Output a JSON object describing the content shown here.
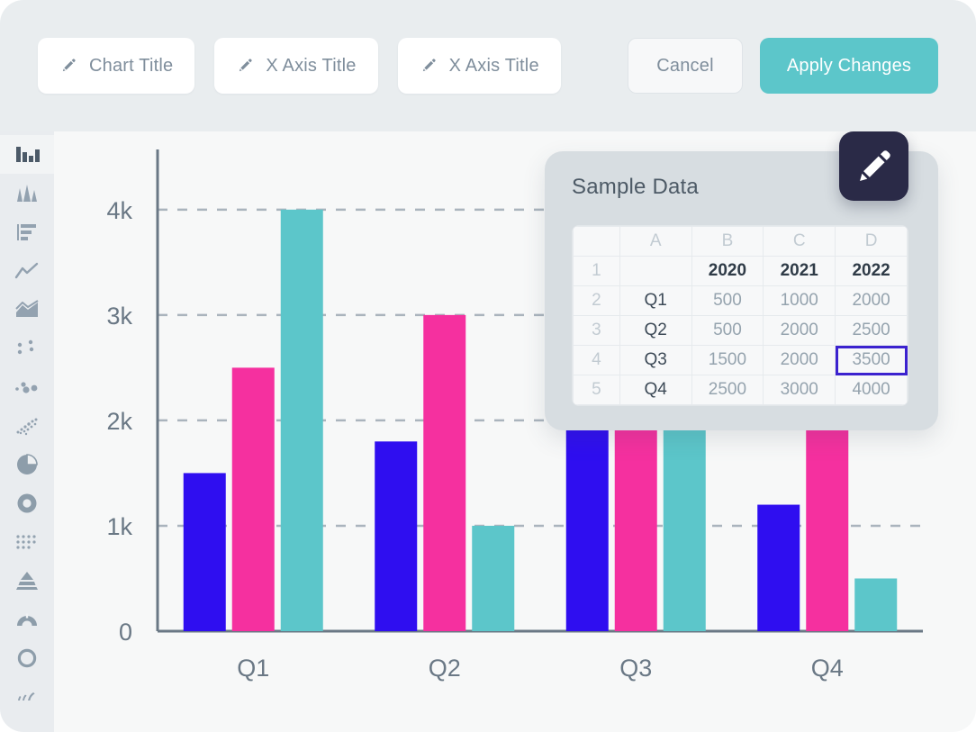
{
  "toolbar": {
    "chips": [
      {
        "icon": "pencil-icon",
        "label": "Chart Title"
      },
      {
        "icon": "pencil-icon",
        "label": "X Axis Title"
      },
      {
        "icon": "pencil-icon",
        "label": "X Axis Title"
      }
    ],
    "cancel_label": "Cancel",
    "apply_label": "Apply Changes",
    "accent_color": "#5cc6ca",
    "background": "#e9edef"
  },
  "sidebar": {
    "items": [
      {
        "name": "bar-chart-icon",
        "active": true
      },
      {
        "name": "column-spike-chart-icon",
        "active": false
      },
      {
        "name": "horizontal-bar-chart-icon",
        "active": false
      },
      {
        "name": "line-chart-icon",
        "active": false
      },
      {
        "name": "area-chart-icon",
        "active": false
      },
      {
        "name": "scatter-plot-icon",
        "active": false
      },
      {
        "name": "bubble-chart-icon",
        "active": false
      },
      {
        "name": "dot-density-chart-icon",
        "active": false
      },
      {
        "name": "pie-chart-icon",
        "active": false
      },
      {
        "name": "donut-chart-icon",
        "active": false
      },
      {
        "name": "dot-matrix-chart-icon",
        "active": false
      },
      {
        "name": "pyramid-chart-icon",
        "active": false
      },
      {
        "name": "gauge-chart-icon",
        "active": false
      },
      {
        "name": "ring-chart-icon",
        "active": false
      },
      {
        "name": "sparkline-chart-icon",
        "active": false
      }
    ]
  },
  "data_panel": {
    "title": "Sample Data",
    "edit_icon": "pencil-icon",
    "accent_selected_border": "#3b22cf",
    "columns": [
      "",
      "A",
      "B",
      "C",
      "D"
    ],
    "rows": [
      {
        "index": "1",
        "cells": [
          "",
          "2020",
          "2021",
          "2022"
        ],
        "style": "header"
      },
      {
        "index": "2",
        "cells": [
          "Q1",
          "500",
          "1000",
          "2000"
        ],
        "style": "data"
      },
      {
        "index": "3",
        "cells": [
          "Q2",
          "500",
          "2000",
          "2500"
        ],
        "style": "data"
      },
      {
        "index": "4",
        "cells": [
          "Q3",
          "1500",
          "2000",
          "3500"
        ],
        "style": "data",
        "selected_col": 3
      },
      {
        "index": "5",
        "cells": [
          "Q4",
          "2500",
          "3000",
          "4000"
        ],
        "style": "data"
      }
    ]
  },
  "chart_data": {
    "type": "bar",
    "title": "",
    "xlabel": "",
    "ylabel": "",
    "categories": [
      "Q1",
      "Q2",
      "Q3",
      "Q4"
    ],
    "series": [
      {
        "name": "2020",
        "color": "#2f0ef0",
        "values": [
          1500,
          1800,
          4000,
          1200
        ]
      },
      {
        "name": "2021",
        "color": "#f5309f",
        "values": [
          2500,
          3000,
          4000,
          4000
        ]
      },
      {
        "name": "2022",
        "color": "#5cc6ca",
        "values": [
          4000,
          1000,
          4000,
          500
        ]
      }
    ],
    "ylim": [
      0,
      4400
    ],
    "yticks": [
      0,
      1000,
      2000,
      3000,
      4000
    ],
    "ytick_labels": [
      "0",
      "1k",
      "2k",
      "3k",
      "4k"
    ],
    "grid": "horizontal-dashed",
    "grid_color": "#aab4bd",
    "axis_color": "#6a7885",
    "legend": "none",
    "plot_background": "#f7f8f8"
  }
}
